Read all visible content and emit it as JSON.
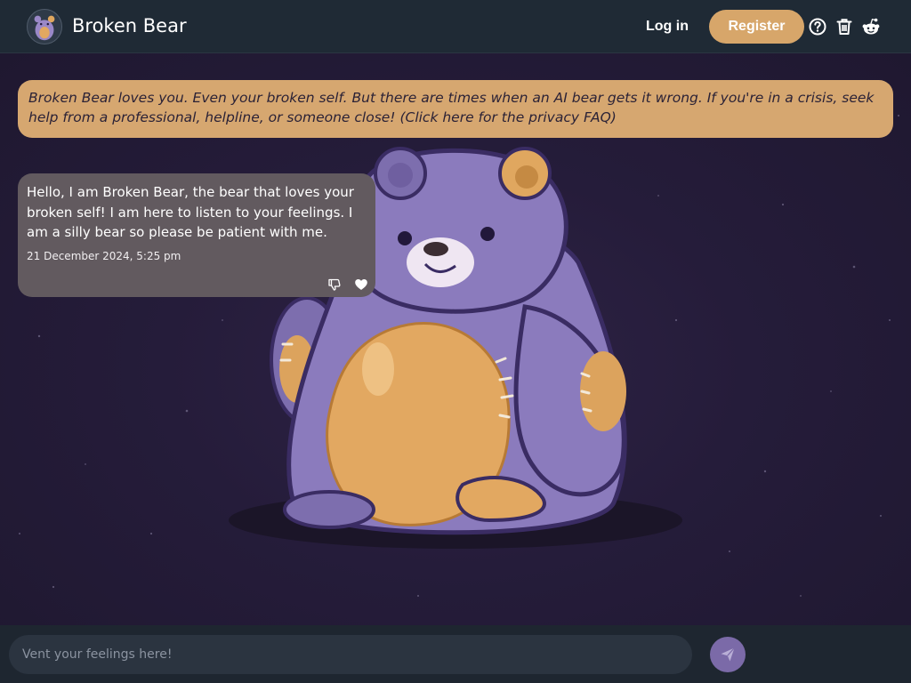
{
  "header": {
    "brand": "Broken Bear",
    "logo_icon": "bear-avatar-icon",
    "login_label": "Log in",
    "register_label": "Register",
    "icons": [
      "help-circle-icon",
      "trash-icon",
      "reddit-icon"
    ]
  },
  "disclaimer": {
    "text": "Broken Bear loves you. Even your broken self. But there are times when an AI bear gets it wrong. If you're in a crisis, seek help from a professional, helpline, or someone close! (Click here for the privacy FAQ)"
  },
  "messages": [
    {
      "text": "Hello, I am Broken Bear, the bear that loves your broken self! I am here to listen to your feelings. I am a silly bear so please be patient with me.",
      "timestamp": "21 December 2024, 5:25 pm",
      "actions": [
        "thumbs-down-icon",
        "heart-icon"
      ]
    }
  ],
  "composer": {
    "placeholder": "Vent your feelings here!",
    "value": "",
    "send_icon": "send-icon"
  },
  "colors": {
    "header_bg": "#1f2a35",
    "accent": "#d7a66a",
    "page_bg": "#251c3a",
    "bubble_bg": "#625a5f",
    "send_button": "#7b6aa8",
    "bear_purple": "#8b7bbd",
    "bear_belly": "#e2a861"
  }
}
